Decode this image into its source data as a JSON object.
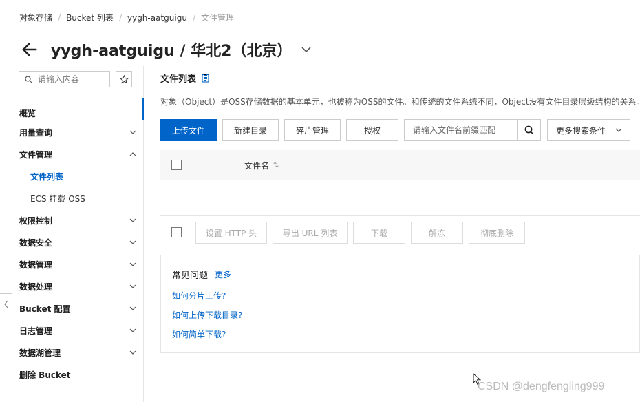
{
  "breadcrumb": {
    "items": [
      "对象存储",
      "Bucket 列表",
      "yygh-aatguigu",
      "文件管理"
    ]
  },
  "header": {
    "title": "yygh-aatguigu / 华北2（北京）"
  },
  "sidebar": {
    "search_placeholder": "请输入内容",
    "items": [
      {
        "label": "概览"
      },
      {
        "label": "用量查询"
      },
      {
        "label": "文件管理"
      },
      {
        "label": "文件列表"
      },
      {
        "label": "ECS 挂载 OSS"
      },
      {
        "label": "权限控制"
      },
      {
        "label": "数据安全"
      },
      {
        "label": "数据管理"
      },
      {
        "label": "数据处理"
      },
      {
        "label": "Bucket 配置"
      },
      {
        "label": "日志管理"
      },
      {
        "label": "数据湖管理"
      },
      {
        "label": "删除 Bucket"
      }
    ]
  },
  "main": {
    "section_title": "文件列表",
    "description": "对象（Object）是OSS存储数据的基本单元，也被称为OSS的文件。和传统的文件系统不同，Object没有文件目录层级结构的关系。",
    "toolbar": {
      "upload": "上传文件",
      "new_dir": "新建目录",
      "fragments": "碎片管理",
      "authorize": "授权",
      "search_placeholder": "请输入文件名前缀匹配",
      "more_filters": "更多搜索条件"
    },
    "table": {
      "col_name": "文件名",
      "sort_glyph": "⇅"
    },
    "bulk_actions": {
      "set_http_header": "设置 HTTP 头",
      "export_url": "导出 URL 列表",
      "download": "下载",
      "unfreeze": "解冻",
      "delete": "彻底删除"
    },
    "faq": {
      "title": "常见问题",
      "more": "更多",
      "links": [
        "如何分片上传?",
        "如何上传下载目录?",
        "如何简单下载?"
      ]
    }
  },
  "watermark": "CSDN @dengfengling999",
  "colors": {
    "primary": "#0064c8",
    "border": "#cccccc",
    "muted": "#aaaaaa"
  }
}
